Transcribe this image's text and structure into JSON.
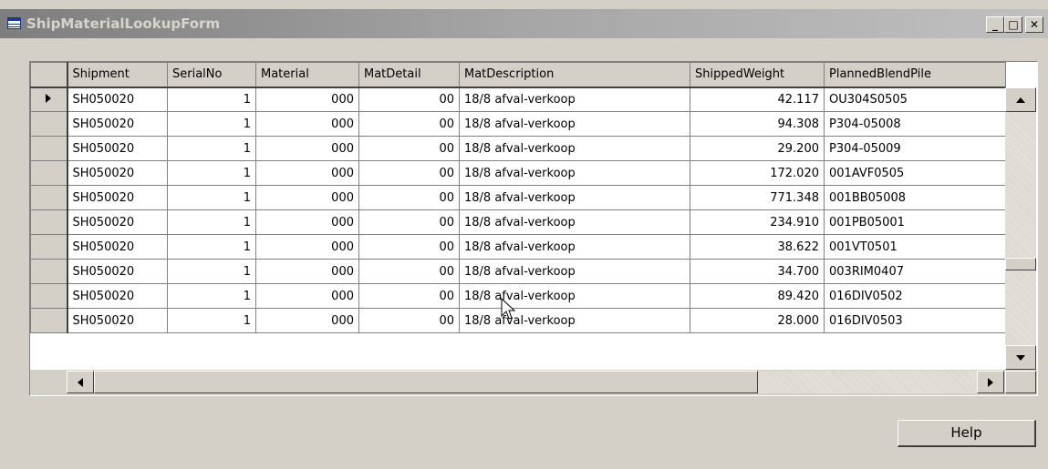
{
  "window": {
    "title": "ShipMaterialLookupForm",
    "controls": {
      "minimize": "_",
      "maximize": "□",
      "close": "✕"
    }
  },
  "grid": {
    "columns": [
      "Shipment",
      "SerialNo",
      "Material",
      "MatDetail",
      "MatDescription",
      "ShippedWeight",
      "PlannedBlendPile"
    ],
    "rows": [
      [
        "SH050020",
        "1",
        "000",
        "00",
        "18/8 afval-verkoop",
        "42.117",
        "OU304S0505"
      ],
      [
        "SH050020",
        "1",
        "000",
        "00",
        "18/8 afval-verkoop",
        "94.308",
        "P304-05008"
      ],
      [
        "SH050020",
        "1",
        "000",
        "00",
        "18/8 afval-verkoop",
        "29.200",
        "P304-05009"
      ],
      [
        "SH050020",
        "1",
        "000",
        "00",
        "18/8 afval-verkoop",
        "172.020",
        "001AVF0505"
      ],
      [
        "SH050020",
        "1",
        "000",
        "00",
        "18/8 afval-verkoop",
        "771.348",
        "001BB05008"
      ],
      [
        "SH050020",
        "1",
        "000",
        "00",
        "18/8 afval-verkoop",
        "234.910",
        "001PB05001"
      ],
      [
        "SH050020",
        "1",
        "000",
        "00",
        "18/8 afval-verkoop",
        "38.622",
        "001VT0501"
      ],
      [
        "SH050020",
        "1",
        "000",
        "00",
        "18/8 afval-verkoop",
        "34.700",
        "003RIM0407"
      ],
      [
        "SH050020",
        "1",
        "000",
        "00",
        "18/8 afval-verkoop",
        "89.420",
        "016DIV0502"
      ],
      [
        "SH050020",
        "1",
        "000",
        "00",
        "18/8 afval-verkoop",
        "28.000",
        "016DIV0503"
      ]
    ],
    "current_row_indicator": "row-pointer-icon"
  },
  "footer": {
    "help_label": "Help"
  },
  "colors": {
    "titlebar_inactive": "#a6a6a6",
    "face": "#d4d0c8"
  }
}
